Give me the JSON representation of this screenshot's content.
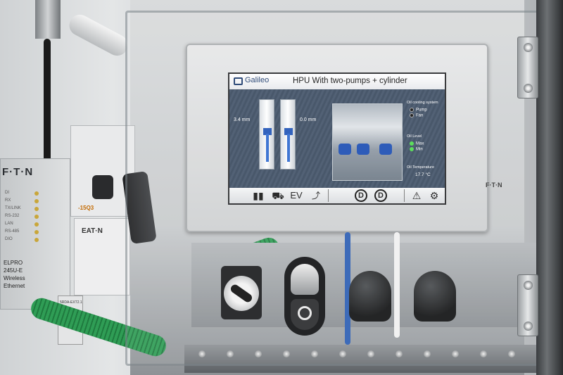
{
  "scene": {
    "type": "photo of industrial control cabinet with HMI touch panel",
    "colors": {
      "screen_bg": "#3e4e63",
      "accent_blue": "#2f6bd0",
      "ribbon_green": "#2f9d55",
      "indicator_green": "#4fdc4f"
    }
  },
  "hmi": {
    "logo_text": "Galileo",
    "title": "HPU With two-pumps + cylinder",
    "cylinder_left_value": "3.4 mm",
    "cylinder_right_value": "0.0 mm",
    "oil_cooling": {
      "label": "Oil cooling system",
      "items": [
        {
          "label": "Pump",
          "state": "off"
        },
        {
          "label": "Fan",
          "state": "off"
        }
      ]
    },
    "oil_level": {
      "label": "Oil Level",
      "items": [
        {
          "label": "Max",
          "state": "on"
        },
        {
          "label": "Min",
          "state": "on"
        }
      ]
    },
    "oil_temperature": {
      "label": "Oil Temperature",
      "value": "17.7 °C"
    },
    "toolbar": {
      "bottles_icon": "bottles-icon",
      "motor_icon": "motor-icon",
      "ev_label": "EV",
      "trend_icon": "trend-chart-icon",
      "d_button_1": "D",
      "d_button_2": "D",
      "warning_icon": "warning-icon",
      "settings_icon": "gears-icon"
    }
  },
  "hardware_labels": {
    "eaton_logo": "F·T·N",
    "led_labels": [
      "DI",
      "RX",
      "TX/LINK",
      "RS-232",
      "LAN",
      "RS-485",
      "DIO"
    ],
    "elpro_lines": [
      "ELPRO",
      "245U-E",
      "Wireless",
      "Ethernet"
    ],
    "breaker_tag": "-15Q3",
    "contactor_brand": "EAT·N",
    "relay_text": "5RDA-EXT2.1",
    "eaton_right": "F·T·N"
  }
}
